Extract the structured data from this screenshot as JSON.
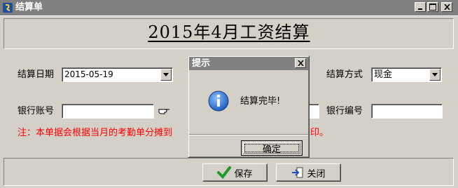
{
  "window": {
    "title": "结算单",
    "controls": {
      "minimize": "_",
      "maximize": "□",
      "close": "×"
    }
  },
  "page_title": "2015年4月工资结算",
  "form": {
    "date_label": "结算日期",
    "date_value": "2015-05-19",
    "method_label": "结算方式",
    "method_value": "现金",
    "account_label": "银行账号",
    "account_value": "",
    "bank_code_label": "银行编号",
    "bank_code_value": "",
    "note": "注：本单据会根据当月的考勤单分摊到",
    "note_tail": "印。"
  },
  "buttons": {
    "save": "保存",
    "close": "关闭"
  },
  "dialog": {
    "title": "提示",
    "message": "结算完毕!",
    "ok": "确定"
  },
  "colors": {
    "note_red": "#ff0000",
    "titlebar": "#808080",
    "info_blue": "#1f5fbf"
  }
}
